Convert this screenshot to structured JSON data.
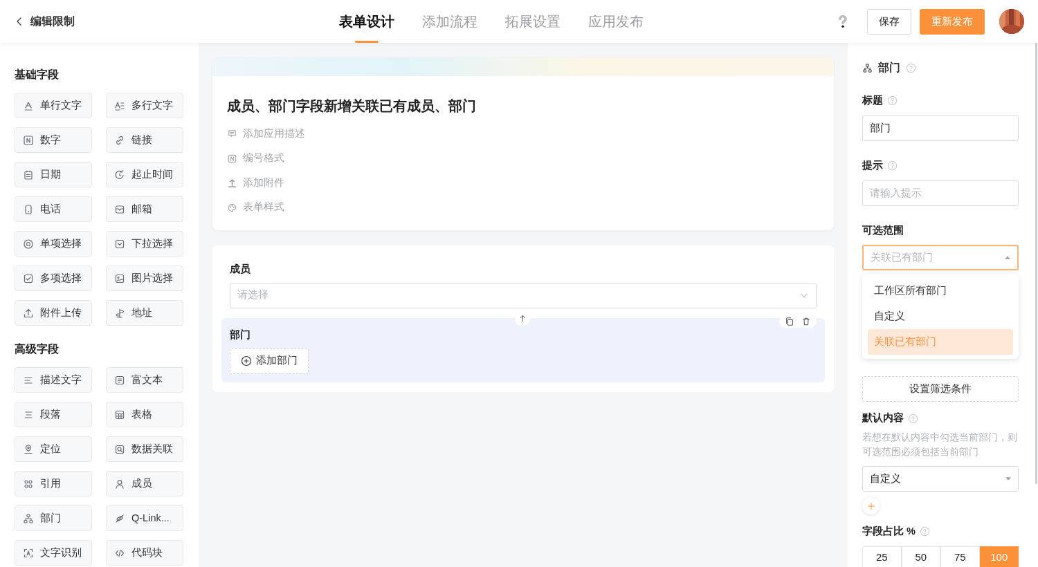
{
  "header": {
    "back_label": "编辑限制",
    "tabs": [
      {
        "label": "表单设计",
        "selected": true
      },
      {
        "label": "添加流程",
        "selected": false
      },
      {
        "label": "拓展设置",
        "selected": false
      },
      {
        "label": "应用发布",
        "selected": false
      }
    ],
    "buttons": [
      {
        "label": "保存",
        "kind": "outline"
      },
      {
        "label": "重新发布",
        "kind": "primary"
      }
    ]
  },
  "sidebar": {
    "sections": [
      {
        "title": "基础字段",
        "items": [
          "单行文字",
          "多行文字",
          "数字",
          "链接",
          "日期",
          "起止时间",
          "电话",
          "邮箱",
          "单项选择",
          "下拉选择",
          "多项选择",
          "图片选择",
          "附件上传",
          "地址"
        ]
      },
      {
        "title": "高级字段",
        "items": [
          "描述文字",
          "富文本",
          "段落",
          "表格",
          "定位",
          "数据关联",
          "引用",
          "成员",
          "部门",
          "Q-Link...",
          "文字识别",
          "代码块"
        ]
      }
    ]
  },
  "form": {
    "title": "成员、部门字段新增关联已有成员、部门",
    "actions": [
      "添加应用描述",
      "编号格式",
      "添加附件",
      "表单样式"
    ],
    "fields": [
      {
        "label": "成员",
        "kind": "select",
        "placeholder": "请选择",
        "selected": false
      },
      {
        "label": "部门",
        "kind": "department",
        "button": "添加部门",
        "selected": true
      }
    ]
  },
  "properties": {
    "field_name": "部门",
    "title_label": "标题",
    "title_value": "部门",
    "hint_label": "提示",
    "hint_placeholder": "请输入提示",
    "range_label": "可选范围",
    "range_value": "关联已有部门",
    "range_expanded": true,
    "range_options": [
      {
        "label": "工作区所有部门",
        "selected": false
      },
      {
        "label": "自定义",
        "selected": false
      },
      {
        "label": "关联已有部门",
        "selected": true
      }
    ],
    "filter_button": "设置筛选条件",
    "default_label": "默认内容",
    "default_note": "若想在默认内容中勾选当前部门，则可选范围必须包括当前部门",
    "default_value": "自定义",
    "width_label": "字段占比 %",
    "width_options": [
      {
        "label": "25",
        "selected": false
      },
      {
        "label": "50",
        "selected": false
      },
      {
        "label": "75",
        "selected": false
      },
      {
        "label": "100",
        "selected": true
      }
    ]
  }
}
